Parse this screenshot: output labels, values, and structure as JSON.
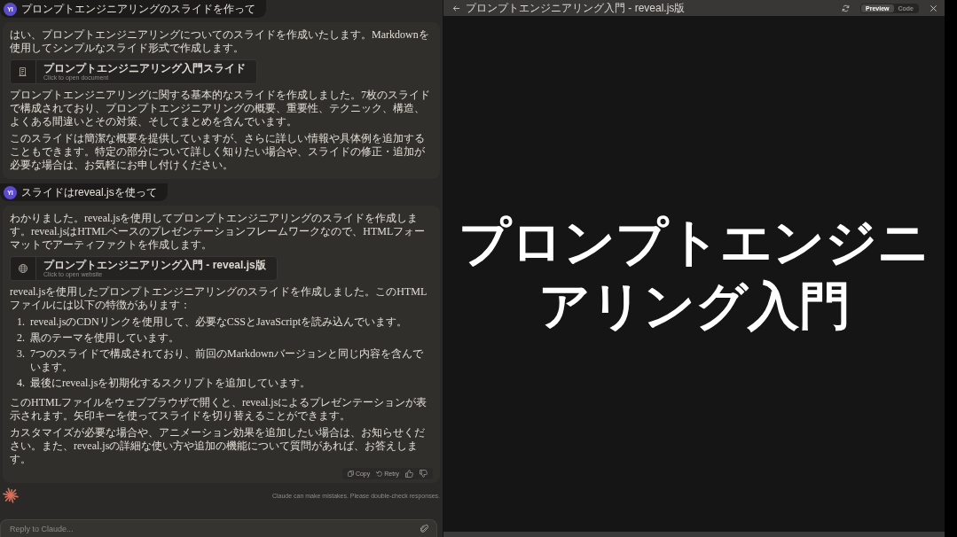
{
  "chat": {
    "messages": [
      {
        "kind": "user",
        "avatar": "YI",
        "text": "プロンプトエンジニアリングのスライドを作って"
      },
      {
        "kind": "assistant",
        "blocks": [
          {
            "kind": "paragraph",
            "text": "はい、プロンプトエンジニアリングについてのスライドを作成いたします。Markdownを使用してシンプルなスライド形式で作成します。"
          },
          {
            "kind": "document_artifact",
            "title": "プロンプトエンジニアリング入門スライド",
            "subtitle": "Click to open document"
          },
          {
            "kind": "paragraph",
            "text": "プロンプトエンジニアリングに関する基本的なスライドを作成しました。7枚のスライドで構成されており、プロンプトエンジニアリングの概要、重要性、テクニック、構造、よくある間違いとその対策、そしてまとめを含んでいます。"
          },
          {
            "kind": "paragraph",
            "text": "このスライドは簡潔な概要を提供していますが、さらに詳しい情報や具体例を追加することもできます。特定の部分について詳しく知りたい場合や、スライドの修正・追加が必要な場合は、お気軽にお申し付けください。"
          }
        ]
      },
      {
        "kind": "user",
        "avatar": "YI",
        "text": "スライドはreveal.jsを使って"
      },
      {
        "kind": "assistant",
        "blocks": [
          {
            "kind": "paragraph",
            "text": "わかりました。reveal.jsを使用してプロンプトエンジニアリングのスライドを作成します。reveal.jsはHTMLベースのプレゼンテーションフレームワークなので、HTMLフォーマットでアーティファクトを作成します。"
          },
          {
            "kind": "website_artifact",
            "title": "プロンプトエンジニアリング入門 - reveal.js版",
            "subtitle": "Click to open website"
          },
          {
            "kind": "paragraph",
            "text": "reveal.jsを使用したプロンプトエンジニアリングのスライドを作成しました。このHTMLファイルには以下の特徴があります："
          },
          {
            "kind": "list",
            "items": [
              {
                "number": "1.",
                "text": "reveal.jsのCDNリンクを使用して、必要なCSSとJavaScriptを読み込んでいます。"
              },
              {
                "number": "2.",
                "text": "黒のテーマを使用しています。"
              },
              {
                "number": "3.",
                "text": "7つのスライドで構成されており、前回のMarkdownバージョンと同じ内容を含んでいます。"
              },
              {
                "number": "4.",
                "text": "最後にreveal.jsを初期化するスクリプトを追加しています。"
              }
            ]
          },
          {
            "kind": "paragraph",
            "text": "このHTMLファイルをウェブブラウザで開くと、reveal.jsによるプレゼンテーションが表示されます。矢印キーを使ってスライドを切り替えることができます。"
          },
          {
            "kind": "paragraph",
            "text": "カスタマイズが必要な場合や、アニメーション効果を追加したい場合は、お知らせください。また、reveal.jsの詳細な使い方や追加の機能について質問があれば、お答えします。"
          }
        ],
        "actions": [
          {
            "kind": "copy",
            "label": "Copy"
          },
          {
            "kind": "retry",
            "label": "Retry"
          },
          {
            "kind": "thumbs_up"
          },
          {
            "kind": "thumbs_down"
          }
        ]
      }
    ],
    "disclaimer": "Claude can make mistakes. Please double-check responses.",
    "composer": {
      "placeholder": "Reply to Claude..."
    }
  },
  "preview": {
    "title": "プロンプトエンジニアリング入門 - reveal.js版",
    "tabs": [
      {
        "label": "Preview",
        "selected": true
      },
      {
        "label": "Code",
        "selected": false
      }
    ],
    "slide": {
      "title": "プロンプトエンジニアリング入門"
    }
  }
}
